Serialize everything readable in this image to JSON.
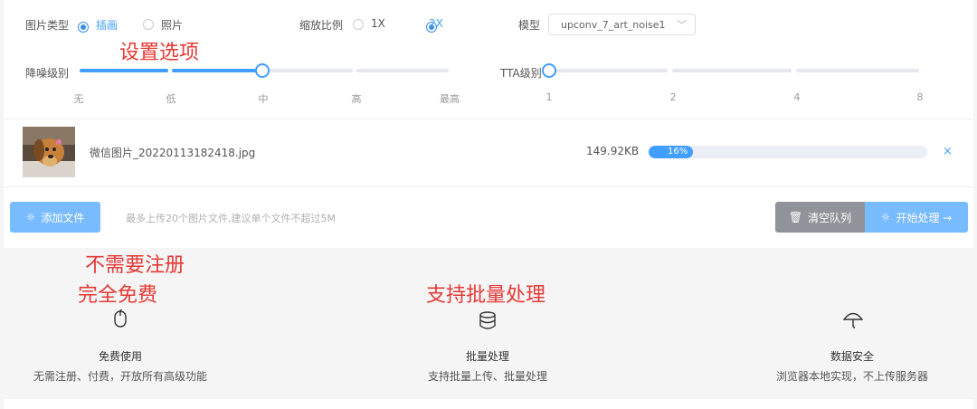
{
  "options": {
    "image_type_label": "图片类型",
    "image_type_options": [
      "插画",
      "照片"
    ],
    "scale_label": "缩放比例",
    "scale_options": [
      "1X",
      "2X"
    ],
    "model_label": "模型",
    "model_value": "upconv_7_art_noise1",
    "noise_label": "降噪级别",
    "noise_ticks": [
      "无",
      "低",
      "中",
      "高",
      "最高"
    ],
    "noise_level": 0.5,
    "tta_label": "TTA级别",
    "tta_ticks": [
      "1",
      "2",
      "4",
      "8"
    ],
    "tta_level": 0
  },
  "file": {
    "name": "微信图片_20220113182418.jpg",
    "size": "149.92KB",
    "progress_text": "16%",
    "progress": 0.16,
    "remove": "×"
  },
  "actions": {
    "add_file": "添加文件",
    "hint": "最多上传20个图片文件,建议单个文件不超过5M",
    "clear_queue": "清空队列",
    "start": "开始处理 →"
  },
  "annotations": {
    "settings": "设置选项",
    "no_register": "不需要注册",
    "free": "完全免费",
    "batch": "支持批量处理"
  },
  "features": [
    {
      "icon": "mouse-icon",
      "title": "免费使用",
      "desc": "无需注册、付费，开放所有高级功能"
    },
    {
      "icon": "database-icon",
      "title": "批量处理",
      "desc": "支持批量上传、批量处理"
    },
    {
      "icon": "umbrella-icon",
      "title": "数据安全",
      "desc": "浏览器本地实现，不上传服务器"
    }
  ],
  "colors": {
    "accent": "#409eff",
    "annotation": "#e53935",
    "disabled": "#909399"
  }
}
